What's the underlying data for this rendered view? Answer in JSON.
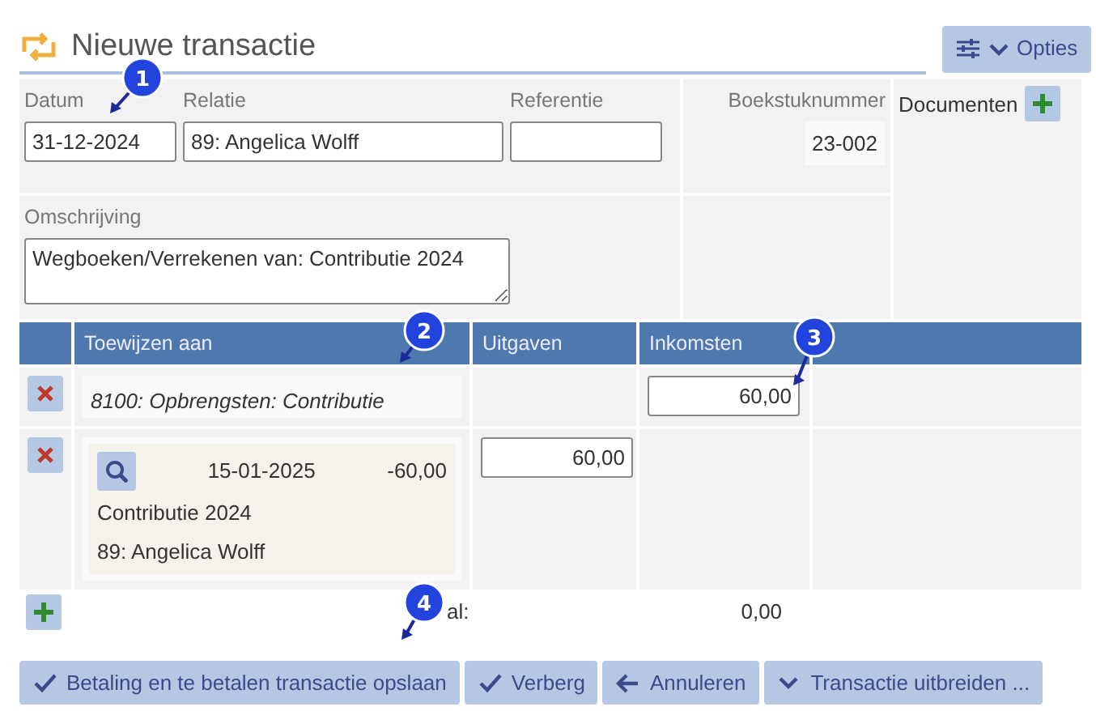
{
  "header": {
    "title": "Nieuwe transactie",
    "options_button": "Opties"
  },
  "form": {
    "date_label": "Datum",
    "date": "31-12-2024",
    "relation_label": "Relatie",
    "relation": "89: Angelica Wolff",
    "reference_label": "Referentie",
    "voucher_label": "Boekstuknummer",
    "voucher": "23-002",
    "documents_label": "Documenten",
    "description_label": "Omschrijving",
    "description": "Wegboeken/Verrekenen van: Contributie 2024"
  },
  "table": {
    "columns": [
      "Toewijzen aan",
      "Uitgaven",
      "Inkomsten"
    ],
    "rows": [
      {
        "kind": "account",
        "account": "8100: Opbrengsten: Contributie",
        "income": "60,00"
      },
      {
        "kind": "payment",
        "date": "15-01-2025",
        "amount": "-60,00",
        "description": "Contributie 2024",
        "relation": "89: Angelica Wolff",
        "expense": "60,00"
      }
    ],
    "total_label": "al:",
    "total": "0,00"
  },
  "buttons": [
    "Betaling en te betalen transactie opslaan",
    "Verberg",
    "Annuleren",
    "Transactie uitbreiden ..."
  ],
  "callouts": [
    {
      "label": "1"
    },
    {
      "label": "2"
    },
    {
      "label": "3"
    },
    {
      "label": "4"
    }
  ]
}
